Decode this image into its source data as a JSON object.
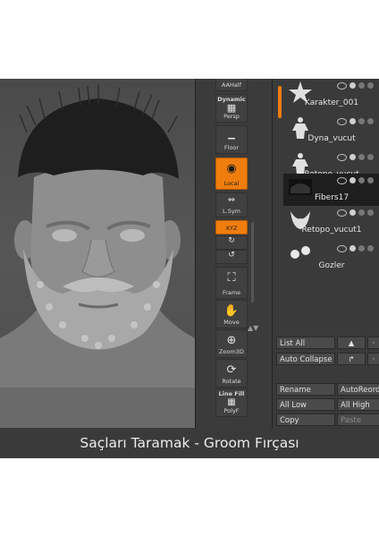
{
  "caption": "Saçları Taramak - Groom Fırçası",
  "shelf": {
    "tools": [
      {
        "name": "aahalf",
        "label": "AAHalf",
        "icon": "aahalf-icon",
        "active": false
      },
      {
        "name": "persp",
        "label": "Persp",
        "top_label": "Dynamic",
        "icon": "grid-icon",
        "active": false
      },
      {
        "name": "floor",
        "label": "Floor",
        "icon": "floor-icon",
        "active": false
      },
      {
        "name": "local",
        "label": "Local",
        "icon": "local-icon",
        "active": true
      },
      {
        "name": "lsym",
        "label": "L.Sym",
        "icon": "lsym-icon",
        "active": false
      },
      {
        "name": "xyz",
        "label": "XYZ",
        "icon": "xyz-icon",
        "active": true
      },
      {
        "name": "frame",
        "label": "Frame",
        "icon": "frame-icon",
        "active": false
      },
      {
        "name": "move",
        "label": "Move",
        "icon": "hand-icon",
        "active": false
      },
      {
        "name": "zoom3d",
        "label": "Zoom3D",
        "icon": "zoom-icon",
        "active": false
      },
      {
        "name": "rotate",
        "label": "Rotate",
        "icon": "rotate-icon",
        "active": false
      },
      {
        "name": "polyf",
        "label": "PolyF",
        "top_label": "Line Fill",
        "icon": "polyf-icon",
        "active": false
      }
    ]
  },
  "subtools": [
    {
      "name": "Karakter_001",
      "thumb": "star-icon",
      "selected": false
    },
    {
      "name": "Dyna_vucut",
      "thumb": "body-icon",
      "selected": false
    },
    {
      "name": "Retopo_vucut",
      "thumb": "body-icon",
      "selected": false
    },
    {
      "name": "Fibers17",
      "thumb": "hair-icon",
      "selected": true
    },
    {
      "name": "Retopo_vucut1",
      "thumb": "beard-icon",
      "selected": false
    },
    {
      "name": "Gozler",
      "thumb": "eyes-icon",
      "selected": false
    }
  ],
  "panel_buttons": {
    "list_all": "List All",
    "auto_collapse": "Auto Collapse",
    "rename": "Rename",
    "auto_reorder": "AutoReorder",
    "all_low": "All Low",
    "all_high": "All High",
    "copy": "Copy",
    "paste": "Paste"
  },
  "colors": {
    "accent": "#ef7d0e",
    "panel_bg": "#3a3a3a",
    "viewport_bg": "#505050"
  }
}
